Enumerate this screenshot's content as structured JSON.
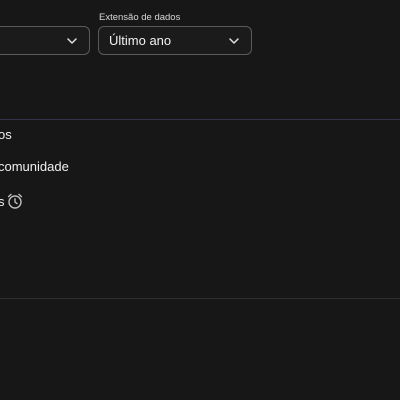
{
  "filters": {
    "left_select": {
      "value": "",
      "icon": "chevron-down-icon"
    },
    "data_range": {
      "label": "Extensão de dados",
      "value": "Último ano",
      "icon": "chevron-down-icon"
    }
  },
  "list": {
    "items": [
      {
        "label": "os"
      },
      {
        "label": "comunidade"
      },
      {
        "label": "s",
        "icon": "alarm-clock-icon"
      }
    ]
  },
  "colors": {
    "background": "#171717",
    "border": "#5a5a5a",
    "divider_accent": "#34314a"
  }
}
